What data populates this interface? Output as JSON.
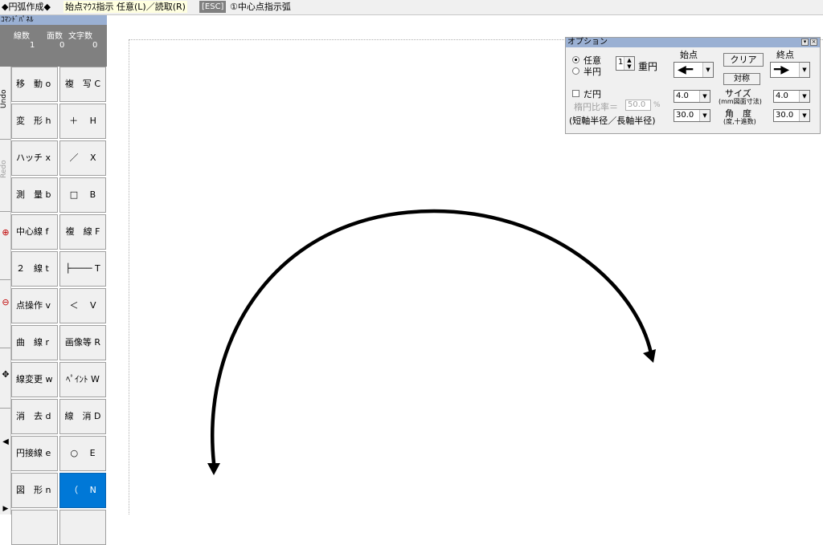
{
  "status_bar": {
    "mode": "◆円弧作成◆",
    "prompt": "始点ﾏｳｽ指示 任意(L)／読取(R)",
    "esc": "[ESC]",
    "center_hint": "①中心点指示弧"
  },
  "command_panel": {
    "title": "ｺﾏﾝﾄﾞﾊﾟﾈﾙ",
    "counts": {
      "labels": [
        "線数",
        "面数",
        "文字数"
      ],
      "values": [
        "1",
        "0",
        "0"
      ]
    },
    "side": {
      "undo": "Undo",
      "redo": "Redo"
    },
    "buttons": [
      {
        "left": "移　動 o",
        "right": "複　写 C"
      },
      {
        "left": "変　形 h",
        "right": "＋　 H"
      },
      {
        "left": "ハッチ x",
        "right": "／　 X"
      },
      {
        "left": "測　量 b",
        "right": "□　 B"
      },
      {
        "left": "中心線 f",
        "right": "複　線 F"
      },
      {
        "left": "２　線 t",
        "right": "├──── T"
      },
      {
        "left": "点操作 v",
        "right": "＜　 V"
      },
      {
        "left": "曲　線 r",
        "right": "画像等 R"
      },
      {
        "left": "線変更 w",
        "right": "ﾍﾟｲﾝﾄ W"
      },
      {
        "left": "消　去 d",
        "right": "線　消 D"
      },
      {
        "left": "円接線 e",
        "right": "○　 E"
      },
      {
        "left": "図　形 n",
        "right": "（　 N"
      }
    ],
    "active_button": "（　 N"
  },
  "options": {
    "title": "オプション",
    "radio_arbitrary": "任意",
    "radio_semicircle": "半円",
    "multiplicity_value": "1",
    "multiplicity_label": "重円",
    "start_label": "始点",
    "end_label": "終点",
    "clear_button": "クリア",
    "symmetric_button": "対称",
    "ellipse_check": "だ円",
    "ellipse_ratio_label": "楕円比率＝",
    "ellipse_ratio_value": "50.0",
    "ellipse_ratio_unit": "%",
    "axis_note": "(短軸半径／長軸半径)",
    "size_label": "サイズ",
    "size_note": "(mm図面寸法)",
    "angle_label": "角　度",
    "angle_note": "(度,十進数)",
    "start_size": "4.0",
    "start_angle": "30.0",
    "end_size": "4.0",
    "end_angle": "30.0"
  },
  "drawing": {
    "description_arrowheads": "both ends",
    "stroke_color": "#000000"
  }
}
